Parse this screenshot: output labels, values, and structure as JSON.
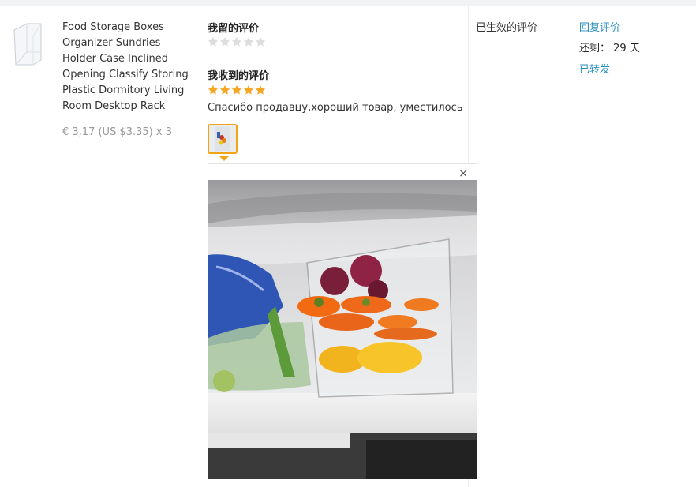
{
  "product": {
    "title": "Food Storage Boxes Organizer Sundries Holder Case Inclined Opening Classify Storing Plastic Dormitory Living Room Desktop Rack",
    "price": "€ 3,17 (US $3.35) x 3",
    "image_icon": "product-box-image"
  },
  "my_review": {
    "heading": "我留的评价",
    "rating": 0,
    "max_rating": 5
  },
  "received_review": {
    "heading": "我收到的评价",
    "rating": 5,
    "max_rating": 5,
    "text": "Спасибо продавцу,хороший товар, уместилось в",
    "photo_icon": "review-photo-thumbnail"
  },
  "preview": {
    "close_label": "×",
    "photo_icon": "fridge-produce-photo"
  },
  "status": {
    "label": "已生效的评价"
  },
  "actions": {
    "reply_label": "回复评价",
    "remaining_label": "还剩：",
    "remaining_value": "29 天",
    "forwarded_label": "已转发"
  },
  "colors": {
    "star_filled": "#f5a623",
    "star_empty": "#dddddd",
    "link": "#2a8fbd",
    "thumb_border": "#f2a417"
  }
}
